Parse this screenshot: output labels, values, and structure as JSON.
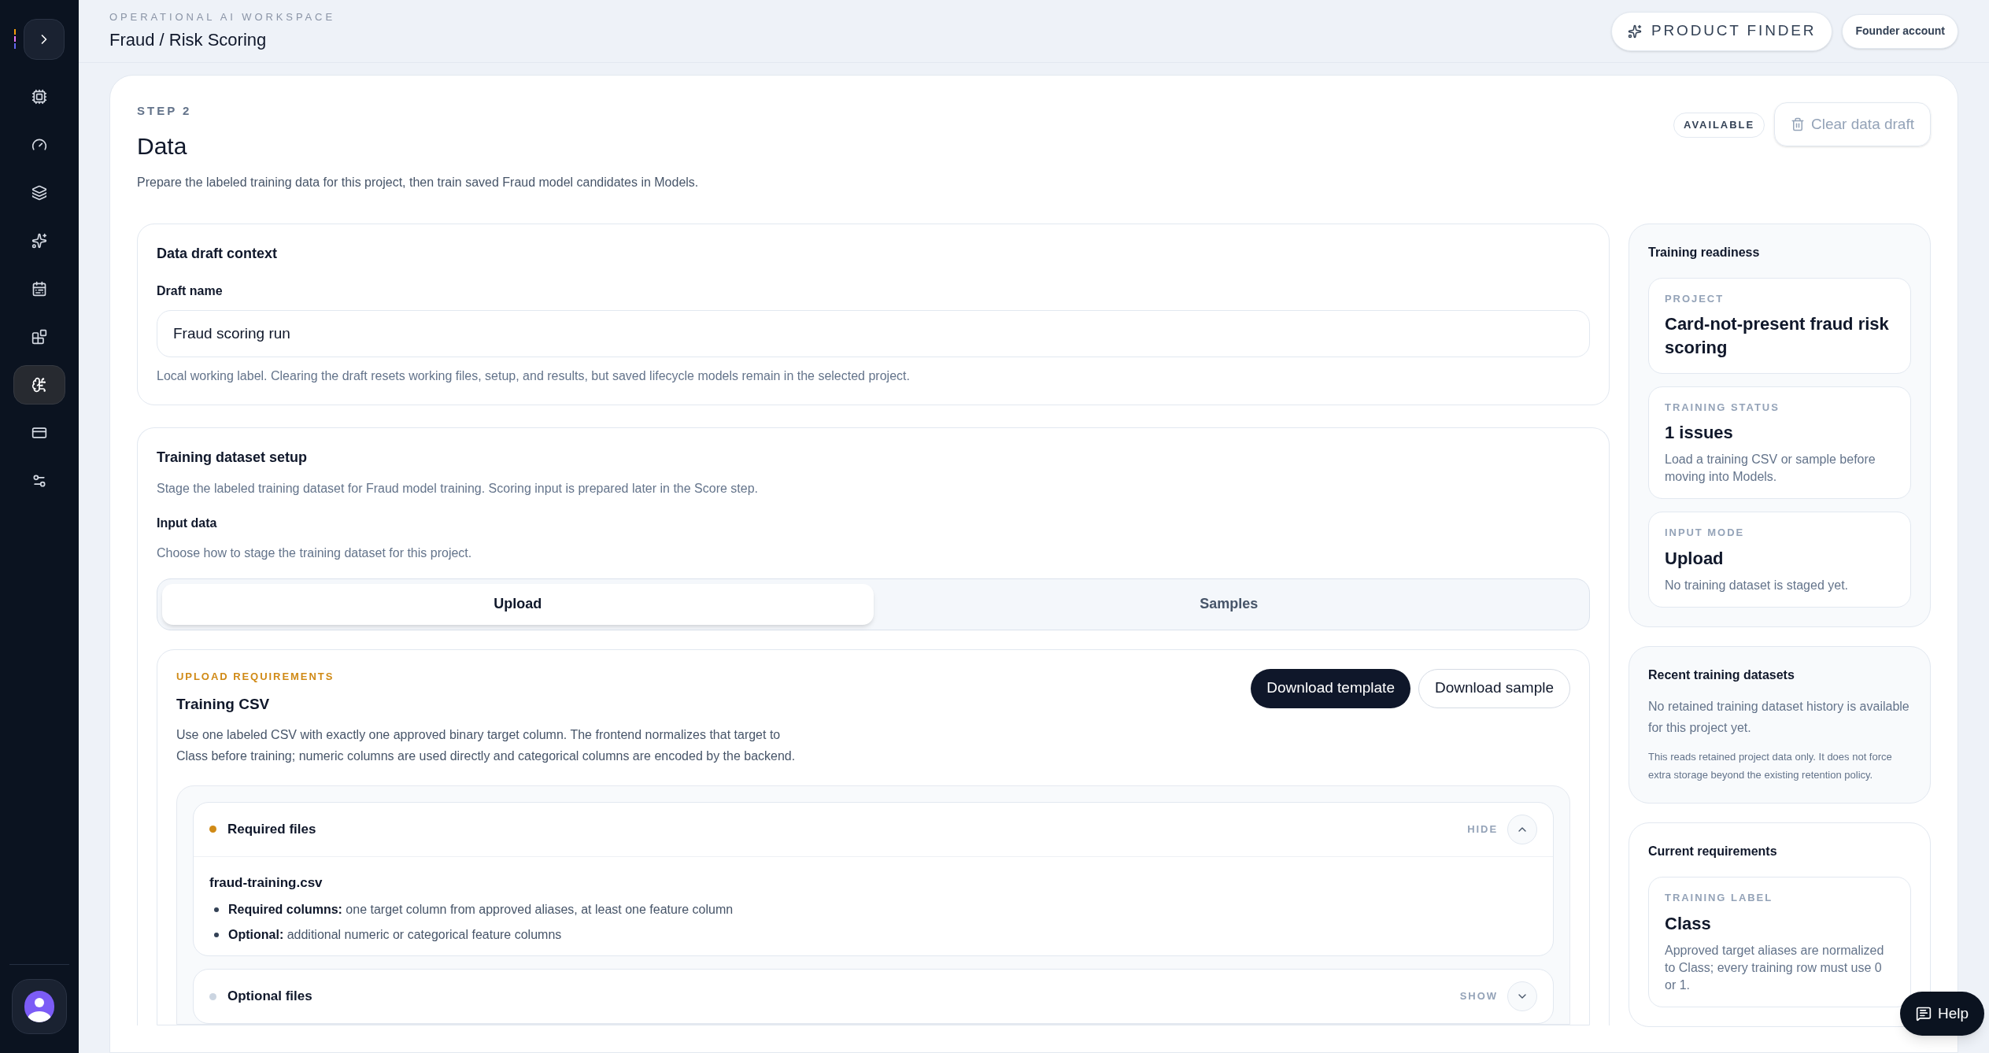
{
  "sidebar": {
    "items": [
      {
        "selected": false
      },
      {
        "selected": false
      },
      {
        "selected": false
      },
      {
        "selected": false
      },
      {
        "selected": false
      },
      {
        "selected": false
      },
      {
        "selected": true
      },
      {
        "selected": false
      },
      {
        "selected": false
      }
    ]
  },
  "header": {
    "eyebrow": "OPERATIONAL AI WORKSPACE",
    "title": "Fraud / Risk Scoring",
    "product_finder": "PRODUCT FINDER",
    "account": "Founder account"
  },
  "step": {
    "eyebrow": "STEP 2",
    "title": "Data",
    "description": "Prepare the labeled training data for this project, then train saved Fraud model candidates in Models.",
    "badge": "AVAILABLE",
    "clear_button": "Clear data draft"
  },
  "draft_context": {
    "title": "Data draft context",
    "label": "Draft name",
    "value": "Fraud scoring run",
    "help": "Local working label. Clearing the draft resets working files, setup, and results, but saved lifecycle models remain in the selected project."
  },
  "dataset_setup": {
    "title": "Training dataset setup",
    "description": "Stage the labeled training dataset for Fraud model training. Scoring input is prepared later in the Score step.",
    "input_label": "Input data",
    "input_help": "Choose how to stage the training dataset for this project.",
    "tabs": [
      {
        "label": "Upload",
        "selected": true
      },
      {
        "label": "Samples",
        "selected": false
      }
    ]
  },
  "upload": {
    "eyebrow": "UPLOAD REQUIREMENTS",
    "title": "Training CSV",
    "description": "Use one labeled CSV with exactly one approved binary target column. The frontend normalizes that target to Class before training; numeric columns are used directly and categorical columns are encoded by the backend.",
    "buttons": [
      {
        "label": "Download template",
        "kind": "primary"
      },
      {
        "label": "Download sample",
        "kind": "secondary"
      }
    ],
    "sections": [
      {
        "title": "Required files",
        "color": "#d08a16",
        "toggle": "HIDE",
        "expanded": true,
        "file": "fraud-training.csv",
        "bullets": [
          "**Required columns:** one target column from approved aliases, at least one feature column",
          "**Optional:** additional numeric or categorical feature columns"
        ]
      },
      {
        "title": "Optional files",
        "color": "#cbd5e1",
        "toggle": "SHOW",
        "expanded": false
      }
    ]
  },
  "readiness": {
    "title": "Training readiness",
    "cards": [
      {
        "eyebrow": "PROJECT",
        "value": "Card-not-present fraud risk scoring"
      },
      {
        "eyebrow": "TRAINING STATUS",
        "value": "1 issues",
        "note": "Load a training CSV or sample before moving into Models."
      },
      {
        "eyebrow": "INPUT MODE",
        "value": "Upload",
        "note": "No training dataset is staged yet."
      }
    ]
  },
  "recent": {
    "title": "Recent training datasets",
    "text": "No retained training dataset history is available for this project yet.",
    "note": "This reads retained project data only. It does not force extra storage beyond the existing retention policy."
  },
  "requirements": {
    "title": "Current requirements",
    "cards": [
      {
        "eyebrow": "TRAINING LABEL",
        "value": "Class",
        "note": "Approved target aliases are normalized to Class; every training row must use 0 or 1."
      }
    ]
  },
  "help_button": "Help"
}
